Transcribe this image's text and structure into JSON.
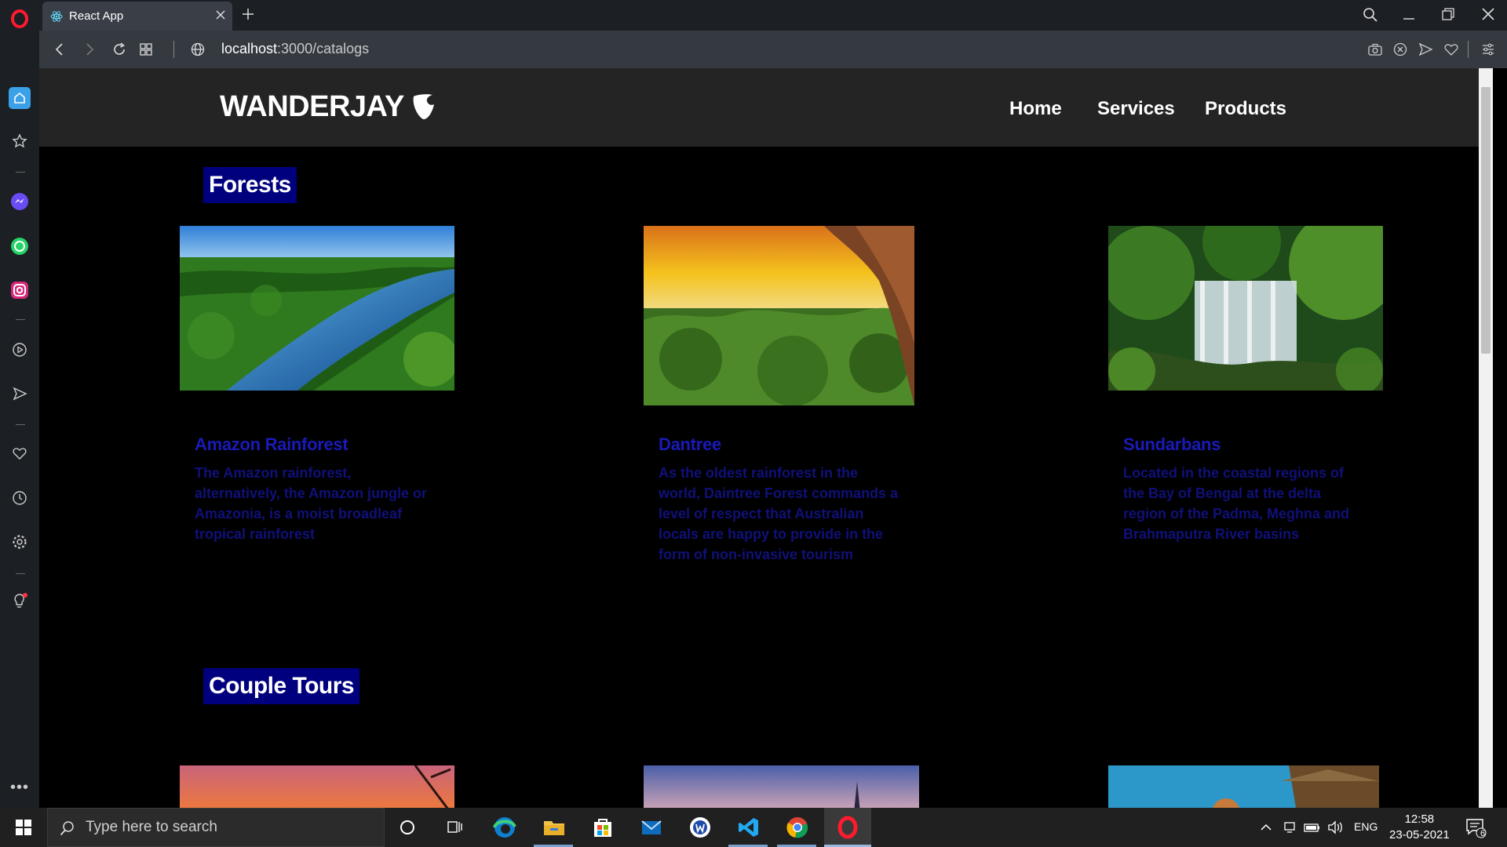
{
  "browser": {
    "tab_title": "React App",
    "url_host": "localhost",
    "url_path": ":3000/catalogs"
  },
  "navbar": {
    "logo": "WANDERJAY",
    "links": [
      "Home",
      "Services",
      "Products"
    ]
  },
  "sections": [
    {
      "title": "Forests",
      "cards": [
        {
          "title": "Amazon Rainforest",
          "desc": "The Amazon rainforest, alternatively, the Amazon jungle or Amazonia, is a moist broadleaf tropical rainforest"
        },
        {
          "title": "Dantree",
          "desc": "As the oldest rainforest in the world, Daintree Forest commands a level of respect that Australian locals are happy to provide in the form of non-invasive tourism"
        },
        {
          "title": "Sundarbans",
          "desc": "Located in the coastal regions of the Bay of Bengal at the delta region of the Padma, Meghna and Brahmaputra River basins"
        }
      ]
    },
    {
      "title": "Couple Tours"
    }
  ],
  "taskbar": {
    "search_placeholder": "Type here to search",
    "lang": "ENG",
    "time": "12:58",
    "date": "23-05-2021",
    "notification_count": "6"
  },
  "colors": {
    "section_title_bg": "#00007e",
    "card_title": "#1a1ab8",
    "card_desc": "#10107a",
    "navbar_bg": "#242424"
  }
}
